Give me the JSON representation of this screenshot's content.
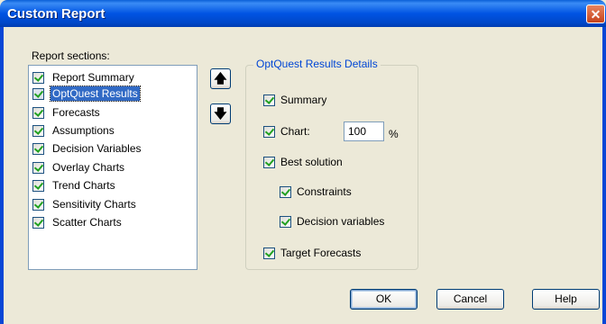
{
  "window": {
    "title": "Custom Report",
    "close_symbol": "✕"
  },
  "report_sections": {
    "label": "Report sections:",
    "items": [
      {
        "label": "Report Summary",
        "checked": true,
        "selected": false
      },
      {
        "label": "OptQuest Results",
        "checked": true,
        "selected": true
      },
      {
        "label": "Forecasts",
        "checked": true,
        "selected": false
      },
      {
        "label": "Assumptions",
        "checked": true,
        "selected": false
      },
      {
        "label": "Decision Variables",
        "checked": true,
        "selected": false
      },
      {
        "label": "Overlay Charts",
        "checked": true,
        "selected": false
      },
      {
        "label": "Trend Charts",
        "checked": true,
        "selected": false
      },
      {
        "label": "Sensitivity Charts",
        "checked": true,
        "selected": false
      },
      {
        "label": "Scatter Charts",
        "checked": true,
        "selected": false
      }
    ]
  },
  "move": {
    "up_symbol": "🡅",
    "down_symbol": "🡇"
  },
  "details": {
    "title": "OptQuest Results Details",
    "summary_label": "Summary",
    "chart_label": "Chart:",
    "chart_value": "100",
    "chart_unit": "%",
    "best_solution_label": "Best solution",
    "constraints_label": "Constraints",
    "decision_variables_label": "Decision variables",
    "target_forecasts_label": "Target Forecasts"
  },
  "buttons": {
    "ok": "OK",
    "cancel": "Cancel",
    "help": "Help"
  },
  "colors": {
    "title_bar": "#0054e3",
    "dialog_bg": "#ece9d8",
    "selection": "#316ac5",
    "group_title": "#0046d5",
    "check_mark": "#21a121"
  }
}
